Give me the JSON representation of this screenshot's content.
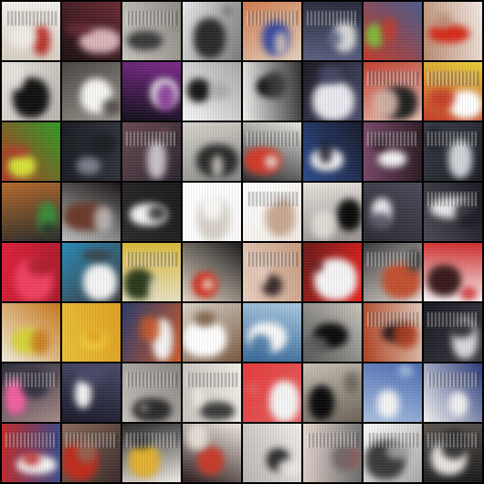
{
  "grid": {
    "rows": 8,
    "cols": 8,
    "border_color": "#000000",
    "tiles": [
      {
        "bg": "#d8cfc4",
        "c1": "#b8342c",
        "c2": "#f3efe9",
        "stripe": true
      },
      {
        "bg": "#1a0f12",
        "c1": "#d9b3b8",
        "c2": "#6b2a33",
        "stripe": false
      },
      {
        "bg": "#c9c6bf",
        "c1": "#3a3a3a",
        "c2": "#8e8a84",
        "stripe": true
      },
      {
        "bg": "#e8e8e8",
        "c1": "#2a2a2a",
        "c2": "#7a7a7a",
        "stripe": false
      },
      {
        "bg": "#d27a4a",
        "c1": "#3a4b9c",
        "c2": "#e2d0c0",
        "stripe": true
      },
      {
        "bg": "#262a3a",
        "c1": "#d9d9d9",
        "c2": "#5a6080",
        "stripe": true
      },
      {
        "bg": "#4a5c8c",
        "c1": "#7fb83a",
        "c2": "#c23a2a",
        "stripe": false
      },
      {
        "bg": "#f3e9e3",
        "c1": "#d52a1a",
        "c2": "#b98a70",
        "stripe": false
      },
      {
        "bg": "#b9b4ad",
        "c1": "#111111",
        "c2": "#e9e4de",
        "stripe": false
      },
      {
        "bg": "#9a958f",
        "c1": "#f5f5f2",
        "c2": "#4a4440",
        "stripe": false
      },
      {
        "bg": "#101018",
        "c1": "#f0f0f0",
        "c2": "#7d2a8c",
        "stripe": false
      },
      {
        "bg": "#f7f7f7",
        "c1": "#161616",
        "c2": "#a8a8a8",
        "stripe": false
      },
      {
        "bg": "#f4f2ef",
        "c1": "#0a0a0a",
        "c2": "#303030",
        "stripe": false
      },
      {
        "bg": "#1a1a22",
        "c1": "#e8e8ee",
        "c2": "#4a4a6a",
        "stripe": false
      },
      {
        "bg": "#c04030",
        "c1": "#202020",
        "c2": "#e6c3b6",
        "stripe": true
      },
      {
        "bg": "#e6d23a",
        "c1": "#ffffff",
        "c2": "#c43a2a",
        "stripe": true
      },
      {
        "bg": "#2f9a22",
        "c1": "#d6e03a",
        "c2": "#b23a2a",
        "stripe": false
      },
      {
        "bg": "#30323a",
        "c1": "#7a7e8a",
        "c2": "#1a1c22",
        "stripe": false
      },
      {
        "bg": "#2a2430",
        "c1": "#c8c0c8",
        "c2": "#6a4a50",
        "stripe": true
      },
      {
        "bg": "#8a8a88",
        "c1": "#2a2a2a",
        "c2": "#d8d4cc",
        "stripe": false
      },
      {
        "bg": "#2a2a30",
        "c1": "#d03a2a",
        "c2": "#e8e6e0",
        "stripe": true
      },
      {
        "bg": "#2a4a8c",
        "c1": "#f4f4f4",
        "c2": "#1a1a2a",
        "stripe": false
      },
      {
        "bg": "#7a4a6a",
        "c1": "#f4f4f4",
        "c2": "#2a1a22",
        "stripe": true
      },
      {
        "bg": "#3a3e4a",
        "c1": "#d0d2d8",
        "c2": "#1a1c22",
        "stripe": true
      },
      {
        "bg": "#b46a2a",
        "c1": "#3a8a3a",
        "c2": "#2a2a2a",
        "stripe": false
      },
      {
        "bg": "#1a1414",
        "c1": "#6a3a2a",
        "c2": "#c0c0c0",
        "stripe": false
      },
      {
        "bg": "#1a1a1a",
        "c1": "#f4f4f4",
        "c2": "#2a2a2a",
        "stripe": false
      },
      {
        "bg": "#fafafa",
        "c1": "#d6d0c8",
        "c2": "#ffffff",
        "stripe": false
      },
      {
        "bg": "#f2ece6",
        "c1": "#c8a890",
        "c2": "#ffffff",
        "stripe": true
      },
      {
        "bg": "#9a9490",
        "c1": "#0a0a0a",
        "c2": "#e6e2dc",
        "stripe": false
      },
      {
        "bg": "#2a2a30",
        "c1": "#e8e8ec",
        "c2": "#4a4a5a",
        "stripe": false
      },
      {
        "bg": "#4a4a52",
        "c1": "#e6e6e8",
        "c2": "#1a1a22",
        "stripe": true
      },
      {
        "bg": "#e0203a",
        "c1": "#f04060",
        "c2": "#a81a2a",
        "stripe": false
      },
      {
        "bg": "#2a8ab8",
        "c1": "#f4f4f4",
        "c2": "#3a3a3a",
        "stripe": false
      },
      {
        "bg": "#d8b83a",
        "c1": "#2a3a1a",
        "c2": "#e8e0c0",
        "stripe": true
      },
      {
        "bg": "#1a1a1a",
        "c1": "#d02a1a",
        "c2": "#e8d8c8",
        "stripe": false
      },
      {
        "bg": "#c89a80",
        "c1": "#3a2a2a",
        "c2": "#e8d0c0",
        "stripe": true
      },
      {
        "bg": "#e8201a",
        "c1": "#f4f4f4",
        "c2": "#6a1a1a",
        "stripe": false
      },
      {
        "bg": "#e8e0da",
        "c1": "#c05030",
        "c2": "#3a3a3a",
        "stripe": true
      },
      {
        "bg": "#fafafa",
        "c1": "#3a1a1a",
        "c2": "#d02a2a",
        "stripe": false
      },
      {
        "bg": "#f0ecd8",
        "c1": "#d6d23a",
        "c2": "#c8781a",
        "stripe": false
      },
      {
        "bg": "#e8c03a",
        "c1": "#f4d040",
        "c2": "#e0a020",
        "stripe": false
      },
      {
        "bg": "#2a3a6a",
        "c1": "#f4f4f4",
        "c2": "#c85a2a",
        "stripe": false
      },
      {
        "bg": "#d8d2c8",
        "c1": "#ffffff",
        "c2": "#7a5a40",
        "stripe": false
      },
      {
        "bg": "#a8c8e0",
        "c1": "#f8f8f8",
        "c2": "#3a6a9a",
        "stripe": false
      },
      {
        "bg": "#c8c4bc",
        "c1": "#0a0a0a",
        "c2": "#5a5a5a",
        "stripe": false
      },
      {
        "bg": "#e0c8b8",
        "c1": "#2a1a1a",
        "c2": "#b04020",
        "stripe": true
      },
      {
        "bg": "#3a3a42",
        "c1": "#d8d8da",
        "c2": "#1a1a22",
        "stripe": true
      },
      {
        "bg": "#a88a8a",
        "c1": "#f060a0",
        "c2": "#2a2a3a",
        "stripe": true
      },
      {
        "bg": "#1a1a2a",
        "c1": "#f4f4f4",
        "c2": "#4a4a6a",
        "stripe": false
      },
      {
        "bg": "#c8c4c0",
        "c1": "#2a2a2a",
        "c2": "#8a8480",
        "stripe": true
      },
      {
        "bg": "#c8c4bc",
        "c1": "#3a3a3a",
        "c2": "#f0ece6",
        "stripe": true
      },
      {
        "bg": "#e83a3a",
        "c1": "#f4f4f4",
        "c2": "#e06060",
        "stripe": false
      },
      {
        "bg": "#c8c2b8",
        "c1": "#0a0a0a",
        "c2": "#6a6258",
        "stripe": false
      },
      {
        "bg": "#4a6ab0",
        "c1": "#f4f4f4",
        "c2": "#a8c0e0",
        "stripe": false
      },
      {
        "bg": "#2a3a7a",
        "c1": "#d8d8e0",
        "c2": "#f4f4f4",
        "stripe": true
      },
      {
        "bg": "#3a4a8a",
        "c1": "#f4f4f4",
        "c2": "#c02a2a",
        "stripe": true
      },
      {
        "bg": "#3a2a2a",
        "c1": "#c02a1a",
        "c2": "#8a6a5a",
        "stripe": true
      },
      {
        "bg": "#f0ebe4",
        "c1": "#e0b030",
        "c2": "#2a2a2a",
        "stripe": true
      },
      {
        "bg": "#2a1a1a",
        "c1": "#c83a2a",
        "c2": "#f0e8e0",
        "stripe": false
      },
      {
        "bg": "#b8b4b0",
        "c1": "#2a2a2a",
        "c2": "#f0ece8",
        "stripe": false
      },
      {
        "bg": "#e8d8d0",
        "c1": "#c83a3a",
        "c2": "#6a6a6a",
        "stripe": true
      },
      {
        "bg": "#fafafa",
        "c1": "#3a3a3a",
        "c2": "#a8a8a8",
        "stripe": true
      },
      {
        "bg": "#5a5450",
        "c1": "#e8e4e0",
        "c2": "#1a1a1a",
        "stripe": true
      }
    ]
  }
}
